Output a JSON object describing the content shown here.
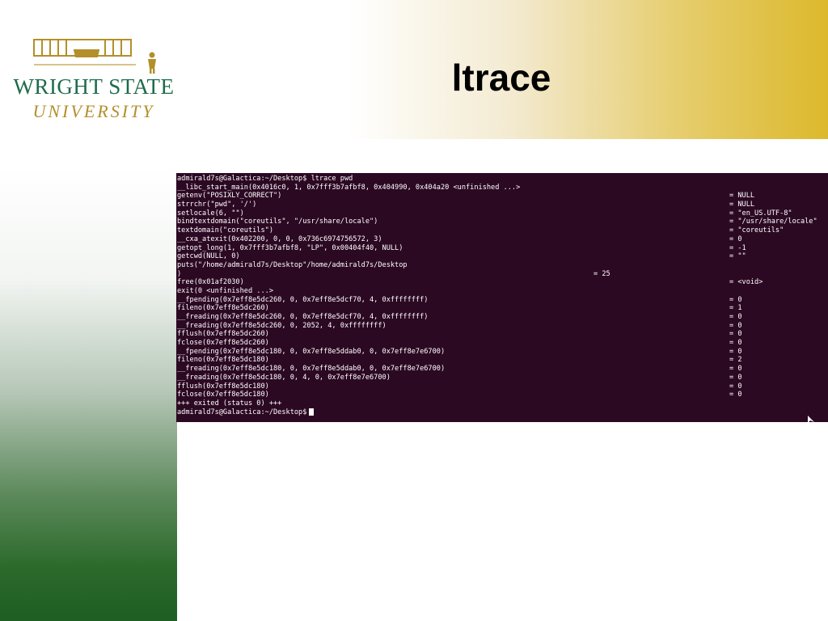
{
  "header": {
    "title": "ltrace",
    "logo": {
      "line1": "WRIGHT STATE",
      "line2": "UNIVERSITY"
    }
  },
  "terminal": {
    "prompt": "admirald7s@Galactica:~/Desktop$ ltrace pwd",
    "lines": [
      {
        "call": "__libc_start_main(0x4016c0, 1, 0x7fff3b7afbf8, 0x404990, 0x404a20 <unfinished ...>",
        "ret": ""
      },
      {
        "call": "getenv(\"POSIXLY_CORRECT\")",
        "ret": "= NULL"
      },
      {
        "call": "strrchr(\"pwd\", '/')",
        "ret": "= NULL"
      },
      {
        "call": "setlocale(6, \"\")",
        "ret": "= \"en_US.UTF-8\""
      },
      {
        "call": "bindtextdomain(\"coreutils\", \"/usr/share/locale\")",
        "ret": "= \"/usr/share/locale\""
      },
      {
        "call": "textdomain(\"coreutils\")",
        "ret": "= \"coreutils\""
      },
      {
        "call": "__cxa_atexit(0x402200, 0, 0, 0x736c6974756572, 3)",
        "ret": "= 0"
      },
      {
        "call": "getopt_long(1, 0x7fff3b7afbf8, \"LP\", 0x00404f40, NULL)",
        "ret": "= -1"
      },
      {
        "call": "getcwd(NULL, 0)",
        "ret": "= \"\""
      },
      {
        "call": "puts(\"/home/admirald7s/Desktop\"/home/admirald7s/Desktop",
        "ret": ""
      },
      {
        "call": ")",
        "ret_mid": "= 25",
        "ret": ""
      },
      {
        "call": "free(0x01af2030)",
        "ret": "= <void>"
      },
      {
        "call": "exit(0 <unfinished ...>",
        "ret": ""
      },
      {
        "call": "__fpending(0x7eff8e5dc260, 0, 0x7eff8e5dcf70, 4, 0xffffffff)",
        "ret": "= 0"
      },
      {
        "call": "fileno(0x7eff8e5dc260)",
        "ret": "= 1"
      },
      {
        "call": "__freading(0x7eff8e5dc260, 0, 0x7eff8e5dcf70, 4, 0xffffffff)",
        "ret": "= 0"
      },
      {
        "call": "__freading(0x7eff8e5dc260, 0, 2052, 4, 0xffffffff)",
        "ret": "= 0"
      },
      {
        "call": "fflush(0x7eff8e5dc260)",
        "ret": "= 0"
      },
      {
        "call": "fclose(0x7eff8e5dc260)",
        "ret": "= 0"
      },
      {
        "call": "__fpending(0x7eff8e5dc180, 0, 0x7eff8e5ddab0, 0, 0x7eff8e7e6700)",
        "ret": "= 0"
      },
      {
        "call": "fileno(0x7eff8e5dc180)",
        "ret": "= 2"
      },
      {
        "call": "__freading(0x7eff8e5dc180, 0, 0x7eff8e5ddab0, 0, 0x7eff8e7e6700)",
        "ret": "= 0"
      },
      {
        "call": "__freading(0x7eff8e5dc180, 0, 4, 0, 0x7eff8e7e6700)",
        "ret": "= 0"
      },
      {
        "call": "fflush(0x7eff8e5dc180)",
        "ret": "= 0"
      },
      {
        "call": "fclose(0x7eff8e5dc180)",
        "ret": "= 0"
      },
      {
        "call": "+++ exited (status 0) +++",
        "ret": ""
      }
    ],
    "final_prompt": "admirald7s@Galactica:~/Desktop$"
  },
  "colors": {
    "terminal_bg": "#2c0923",
    "header_gold": "#dcb92c",
    "logo_green": "#1d6b4d",
    "logo_gold": "#b38f2a",
    "side_green": "#1f5e22"
  }
}
